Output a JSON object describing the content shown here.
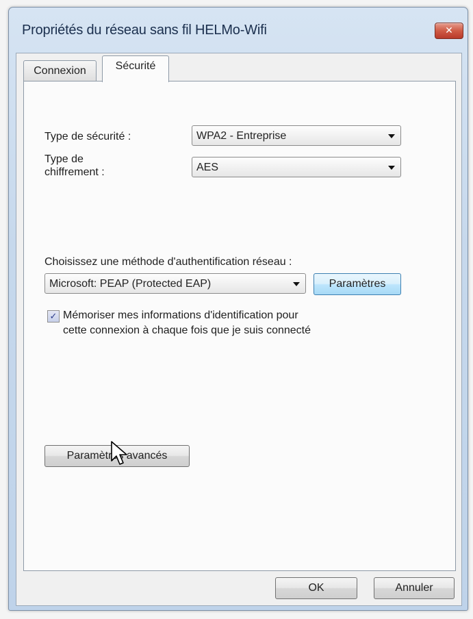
{
  "window": {
    "title": "Propriétés du réseau sans fil HELMo-Wifi",
    "close_glyph": "✕"
  },
  "tabs": [
    {
      "label": "Connexion",
      "active": false
    },
    {
      "label": "Sécurité",
      "active": true
    }
  ],
  "security": {
    "type_label": "Type de sécurité :",
    "type_value": "WPA2 - Entreprise",
    "encryption_label_line1": "Type de",
    "encryption_label_line2": "chiffrement :",
    "encryption_value": "AES"
  },
  "auth": {
    "label": "Choisissez une méthode d'authentification réseau :",
    "method_value": "Microsoft: PEAP (Protected EAP)",
    "settings_button": "Paramètres",
    "remember_checked": true,
    "remember_line1": "Mémoriser mes informations d'identification pour",
    "remember_line2": "cette connexion à chaque fois que je suis connecté"
  },
  "advanced_button": "Paramètres avancés",
  "footer": {
    "ok": "OK",
    "cancel": "Annuler"
  },
  "icons": {
    "checkmark": "✓",
    "cursor": "arrow-cursor-icon"
  }
}
